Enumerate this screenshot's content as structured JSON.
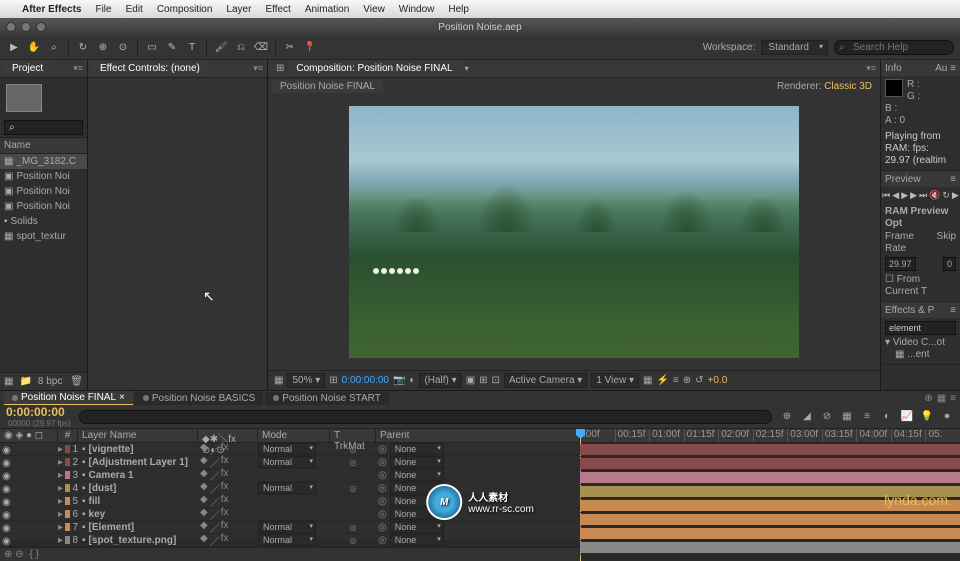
{
  "menubar": {
    "app": "After Effects",
    "items": [
      "File",
      "Edit",
      "Composition",
      "Layer",
      "Effect",
      "Animation",
      "View",
      "Window",
      "Help"
    ],
    "apple": ""
  },
  "titlebar": {
    "title": "Position Noise.aep"
  },
  "toolbar": {
    "workspace_label": "Workspace:",
    "workspace_value": "Standard",
    "search_placeholder": "Search Help"
  },
  "project": {
    "tab": "Project",
    "search_placeholder": "",
    "col_name": "Name",
    "items": [
      {
        "label": "_MG_3182.C",
        "icon": "img",
        "sel": true
      },
      {
        "label": "Position Noi",
        "icon": "comp"
      },
      {
        "label": "Position Noi",
        "icon": "comp"
      },
      {
        "label": "Position Noi",
        "icon": "comp"
      },
      {
        "label": "Solids",
        "icon": "folder"
      },
      {
        "label": "spot_textur",
        "icon": "img"
      }
    ],
    "bpc": "8 bpc"
  },
  "effect_controls": {
    "tab": "Effect Controls: (none)"
  },
  "composition": {
    "panel_tab": "Composition: Position Noise FINAL",
    "comp_tab": "Position Noise FINAL",
    "renderer_label": "Renderer:",
    "renderer_value": "Classic 3D",
    "footer": {
      "zoom": "50%",
      "time": "0:00:00:00",
      "res": "(Half)",
      "camera": "Active Camera",
      "views": "1 View",
      "exposure": "+0.0"
    }
  },
  "right": {
    "info": {
      "title": "Info",
      "r": "R :",
      "g": "G :",
      "b": "B :",
      "a": "A : 0",
      "status": "Playing from RAM:\nfps: 29.97 (realtim"
    },
    "preview": {
      "title": "Preview",
      "ram_label": "RAM Preview Opt",
      "fr_label": "Frame Rate",
      "skip_label": "Skip",
      "fr_value": "29.97",
      "skip_value": "0",
      "from_current": "From Current T"
    },
    "effects": {
      "title": "Effects & P",
      "search_value": "element",
      "group": "Video C...ot",
      "item": "...ent"
    }
  },
  "timeline": {
    "tabs": [
      {
        "label": "Position Noise FINAL",
        "active": true
      },
      {
        "label": "Position Noise BASICS",
        "active": false
      },
      {
        "label": "Position Noise START",
        "active": false
      }
    ],
    "timecode": "0:00:00:00",
    "timecode_sub": "00000 (29.97 fps)",
    "headers": {
      "num": "#",
      "name": "Layer Name",
      "mode": "Mode",
      "trk": "T  TrkMat",
      "parent": "Parent"
    },
    "ruler": [
      ":00f",
      "00:15f",
      "01:00f",
      "01:15f",
      "02:00f",
      "02:15f",
      "03:00f",
      "03:15f",
      "04:00f",
      "04:15f",
      "05:"
    ],
    "layers": [
      {
        "n": "1",
        "color": "#884a4a",
        "name": "[vignette]",
        "mode": "Normal",
        "parent": "None",
        "bar": "#884a4a"
      },
      {
        "n": "2",
        "color": "#884a4a",
        "name": "[Adjustment Layer 1]",
        "mode": "Normal",
        "parent": "None",
        "bar": "#884a4a"
      },
      {
        "n": "3",
        "color": "#b87a8a",
        "name": "Camera 1",
        "mode": "",
        "parent": "None",
        "bar": "#b87a8a"
      },
      {
        "n": "4",
        "color": "#a89050",
        "name": "[dust]",
        "mode": "Normal",
        "parent": "None",
        "bar": "#a89050"
      },
      {
        "n": "5",
        "color": "#c88a50",
        "name": "fill",
        "mode": "",
        "parent": "None",
        "bar": "#c88a50"
      },
      {
        "n": "6",
        "color": "#c88a50",
        "name": "key",
        "mode": "",
        "parent": "None",
        "bar": "#c88a50"
      },
      {
        "n": "7",
        "color": "#c88a50",
        "name": "[Element]",
        "mode": "Normal",
        "parent": "None",
        "bar": "#c88a50"
      },
      {
        "n": "8",
        "color": "#888",
        "name": "[spot_texture.png]",
        "mode": "Normal",
        "parent": "None",
        "bar": "#888"
      }
    ]
  },
  "watermark": {
    "brand": "人人素材",
    "url": "www.rr-sc.com",
    "logo": "M"
  },
  "lynda": "lynda.com"
}
